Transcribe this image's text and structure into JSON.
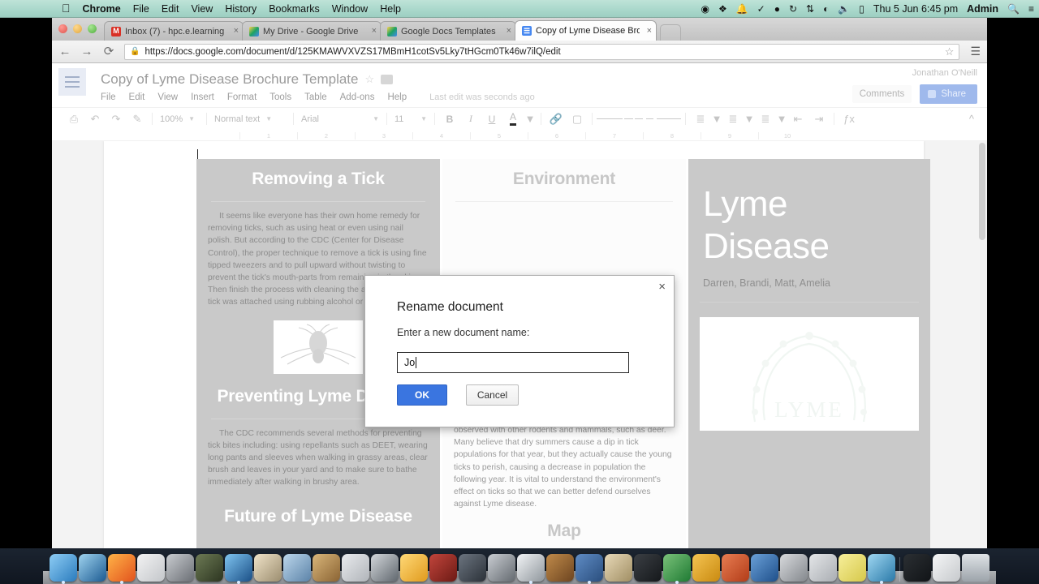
{
  "menubar": {
    "apple_icon": "apple-icon",
    "items": [
      "Chrome",
      "File",
      "Edit",
      "View",
      "History",
      "Bookmarks",
      "Window",
      "Help"
    ],
    "status_icons": [
      "record-icon",
      "dropbox-icon",
      "bell-icon",
      "checkmark-icon",
      "shield-icon",
      "timemachine-icon",
      "bluetooth-icon",
      "wifi-icon",
      "volume-icon",
      "battery-icon"
    ],
    "clock": "Thu 5 Jun  6:45 pm",
    "user": "Admin",
    "search_icon": "search-icon",
    "notification_icon": "notification-center-icon"
  },
  "browser": {
    "tabs": [
      {
        "title": "Inbox (7) - hpc.e.learning",
        "favicon": "gmail-icon",
        "active": false
      },
      {
        "title": "My Drive - Google Drive",
        "favicon": "drive-icon",
        "active": false
      },
      {
        "title": "Google Docs Templates",
        "favicon": "drive-icon",
        "active": false
      },
      {
        "title": "Copy of Lyme Disease Broc",
        "favicon": "docs-icon",
        "active": true
      }
    ],
    "close_label": "×",
    "new_tab_label": "+",
    "back_icon": "←",
    "forward_icon": "→",
    "reload_icon": "⟳",
    "lock_icon": "🔒",
    "url": "https://docs.google.com/document/d/125KMAWVXVZS17MBmH1cotSv5Lky7tHGcm0Tk46w7ilQ/edit",
    "star_icon": "☆",
    "menu_icon": "☰"
  },
  "docs": {
    "title": "Copy of Lyme Disease Brochure Template",
    "star_icon": "star-icon",
    "folder_icon": "folder-icon",
    "menu": [
      "File",
      "Edit",
      "View",
      "Insert",
      "Format",
      "Tools",
      "Table",
      "Add-ons",
      "Help"
    ],
    "last_edit": "Last edit was seconds ago",
    "account": "Jonathan O'Neill",
    "comments_label": "Comments",
    "share_label": "Share",
    "toolbar": {
      "print_icon": "🖨",
      "undo_icon": "↶",
      "redo_icon": "↷",
      "paint_icon": "✐",
      "zoom": "100%",
      "style": "Normal text",
      "font": "Arial",
      "size": "11",
      "bold": "B",
      "italic": "I",
      "underline": "U",
      "text_color": "A",
      "link_icon": "🔗",
      "image_icon": "image-icon",
      "fx_label": "ƒx",
      "collapse_icon": "«"
    },
    "ruler_ticks": [
      "1",
      "2",
      "3",
      "4",
      "5",
      "6",
      "7",
      "8",
      "9",
      "10"
    ]
  },
  "brochure": {
    "left": {
      "heading1": "Removing a Tick",
      "body1": "It seems like everyone has their own home remedy for removing ticks, such as using heat or even using nail polish. But according to the CDC (Center for Disease Control), the proper technique to remove a tick is using fine tipped tweezers and to pull upward without twisting to prevent  the tick's mouth-parts from remaining in the skin. Then finish the process with cleaning the area where the tick was attached using rubbing alcohol or soap and water.",
      "image": "tick-illustration",
      "heading2": "Preventing Lyme Disease",
      "body2": "The CDC recommends several methods for preventing tick bites including: using repellants such as DEET, wearing long pants and sleeves when walking in grassy areas, clear brush and leaves in your yard and to make sure to bathe immediately after walking in brushy area.",
      "heading3_cut": "Future of Lyme Disease"
    },
    "mid": {
      "heading1": "Environment",
      "body1": "populations. This explains why tick populations tend to be down a year and a half after a severe winter. Cold winters knock mouse populations; this in turn reduces the probability of a tick larvae finding a host in the spring and maturing the following year. The same effect can be observed with other rodents and mammals, such as deer. Many believe that dry summers cause a dip in tick populations for that year, but they actually cause the young ticks to perish, causing a decrease in population the following year. It is vital to understand the environment's effect on ticks so that we can better defend ourselves against Lyme disease.",
      "heading2_cut": "Map"
    },
    "right": {
      "title_line1": "Lyme",
      "title_line2": "Disease",
      "authors": "Darren, Brandi, Matt, Amelia",
      "logo_text": "LYME",
      "logo": "lyme-wreath-logo"
    }
  },
  "dialog": {
    "title": "Rename document",
    "label": "Enter a new document name:",
    "input_value": "Jo",
    "ok_label": "OK",
    "cancel_label": "Cancel",
    "close_icon": "×"
  },
  "dock": {
    "items": [
      {
        "name": "finder",
        "color": "linear-gradient(135deg,#8ecdf5,#2a7bbd)"
      },
      {
        "name": "dashboard",
        "color": "linear-gradient(135deg,#9fd3ef,#1b5a91)"
      },
      {
        "name": "firefox",
        "color": "linear-gradient(135deg,#ffb347,#e2521d)"
      },
      {
        "name": "launchpad",
        "color": "linear-gradient(135deg,#f3f3f3,#c3c6ca)"
      },
      {
        "name": "dvd-player",
        "color": "linear-gradient(135deg,#c9ccd0,#6a6e74)"
      },
      {
        "name": "screenflow",
        "color": "linear-gradient(135deg,#6d7a55,#2c3520)"
      },
      {
        "name": "activity-monitor",
        "color": "linear-gradient(135deg,#7fc4f0,#1a4f86)"
      },
      {
        "name": "iphoto",
        "color": "linear-gradient(135deg,#f0e3c8,#9b8d6f)"
      },
      {
        "name": "safari",
        "color": "linear-gradient(135deg,#bcd7ec,#5c83a8)"
      },
      {
        "name": "contacts",
        "color": "linear-gradient(135deg,#d9b67a,#8a6333)"
      },
      {
        "name": "calculator",
        "color": "linear-gradient(135deg,#e9ebee,#b0b4b9)"
      },
      {
        "name": "itunes",
        "color": "linear-gradient(135deg,#d3d7db,#5f666d)"
      },
      {
        "name": "ibooks",
        "color": "linear-gradient(135deg,#ffd977,#e09a1d)"
      },
      {
        "name": "garageband",
        "color": "linear-gradient(135deg,#c2453c,#6c1a14)"
      },
      {
        "name": "imovie",
        "color": "linear-gradient(135deg,#6c7580,#2b3138)"
      },
      {
        "name": "final-cut",
        "color": "linear-gradient(135deg,#c9cdd2,#63696f)"
      },
      {
        "name": "chrome",
        "color": "linear-gradient(135deg,#f2f4f6,#8f969c)"
      },
      {
        "name": "guitar",
        "color": "linear-gradient(135deg,#c08a4a,#6d4520)"
      },
      {
        "name": "keynote",
        "color": "linear-gradient(135deg,#5f8cc5,#2a4e7d)"
      },
      {
        "name": "pages-tools",
        "color": "linear-gradient(135deg,#e8d9b8,#a08e63)"
      },
      {
        "name": "sketch-pen",
        "color": "linear-gradient(135deg,#3b3f44,#15181b)"
      },
      {
        "name": "excel",
        "color": "linear-gradient(135deg,#7ac27a,#1f7a33)"
      },
      {
        "name": "outlook",
        "color": "linear-gradient(135deg,#f5c452,#c98a10)"
      },
      {
        "name": "powerpoint",
        "color": "linear-gradient(135deg,#e87d52,#b23c18)"
      },
      {
        "name": "word",
        "color": "linear-gradient(135deg,#6aa0d8,#1e4f8a)"
      },
      {
        "name": "system-preferences",
        "color": "linear-gradient(135deg,#d8dadd,#83878c)"
      },
      {
        "name": "notes-app",
        "color": "linear-gradient(135deg,#e4e6e8,#a9adb2)"
      },
      {
        "name": "stickies",
        "color": "linear-gradient(135deg,#f7ef9b,#d6c84a)"
      },
      {
        "name": "facetime",
        "color": "linear-gradient(135deg,#9fd7f2,#2a79a8)"
      }
    ],
    "stack_docs": {
      "name": "documents-stack",
      "color": "linear-gradient(135deg,#2b2f33,#111417)"
    },
    "stack_list": {
      "name": "list-stack",
      "color": "linear-gradient(135deg,#f5f6f7,#c6c9cc)"
    },
    "trash": {
      "name": "trash-icon"
    }
  }
}
